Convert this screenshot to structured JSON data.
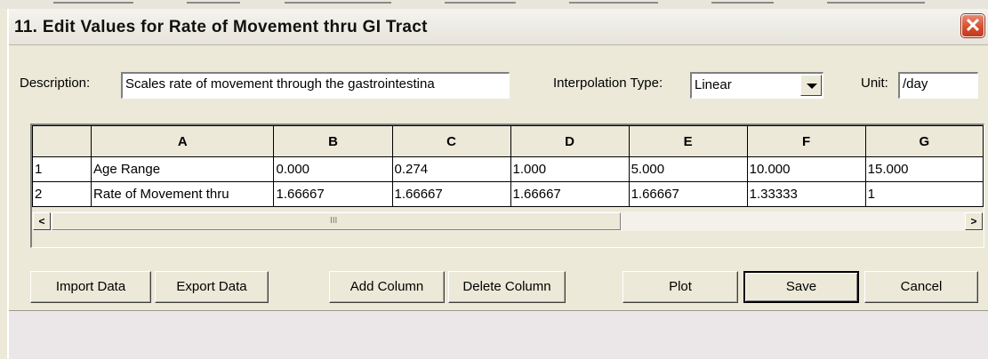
{
  "window": {
    "title": "11. Edit Values for Rate of Movement thru GI Tract"
  },
  "close_icon_glyph": "✕",
  "form": {
    "description_label": "Description:",
    "description_value": "Scales rate of movement through the gastrointestina",
    "interpolation_label": "Interpolation Type:",
    "interpolation_value": "Linear",
    "unit_label": "Unit:",
    "unit_value": "/day"
  },
  "grid": {
    "columns": [
      "",
      "A",
      "B",
      "C",
      "D",
      "E",
      "F",
      "G"
    ],
    "rows": [
      [
        "1",
        "Age Range",
        "0.000",
        "0.274",
        "1.000",
        "5.000",
        "10.000",
        "15.000"
      ],
      [
        "2",
        "Rate of Movement thru",
        "1.66667",
        "1.66667",
        "1.66667",
        "1.66667",
        "1.33333",
        "1"
      ]
    ]
  },
  "scrollbar": {
    "left_glyph": "<",
    "right_glyph": ">",
    "grip_glyph": "III"
  },
  "buttons": {
    "import": "Import Data",
    "export": "Export Data",
    "add_column": "Add Column",
    "delete_column": "Delete Column",
    "plot": "Plot",
    "save": "Save",
    "cancel": "Cancel"
  }
}
